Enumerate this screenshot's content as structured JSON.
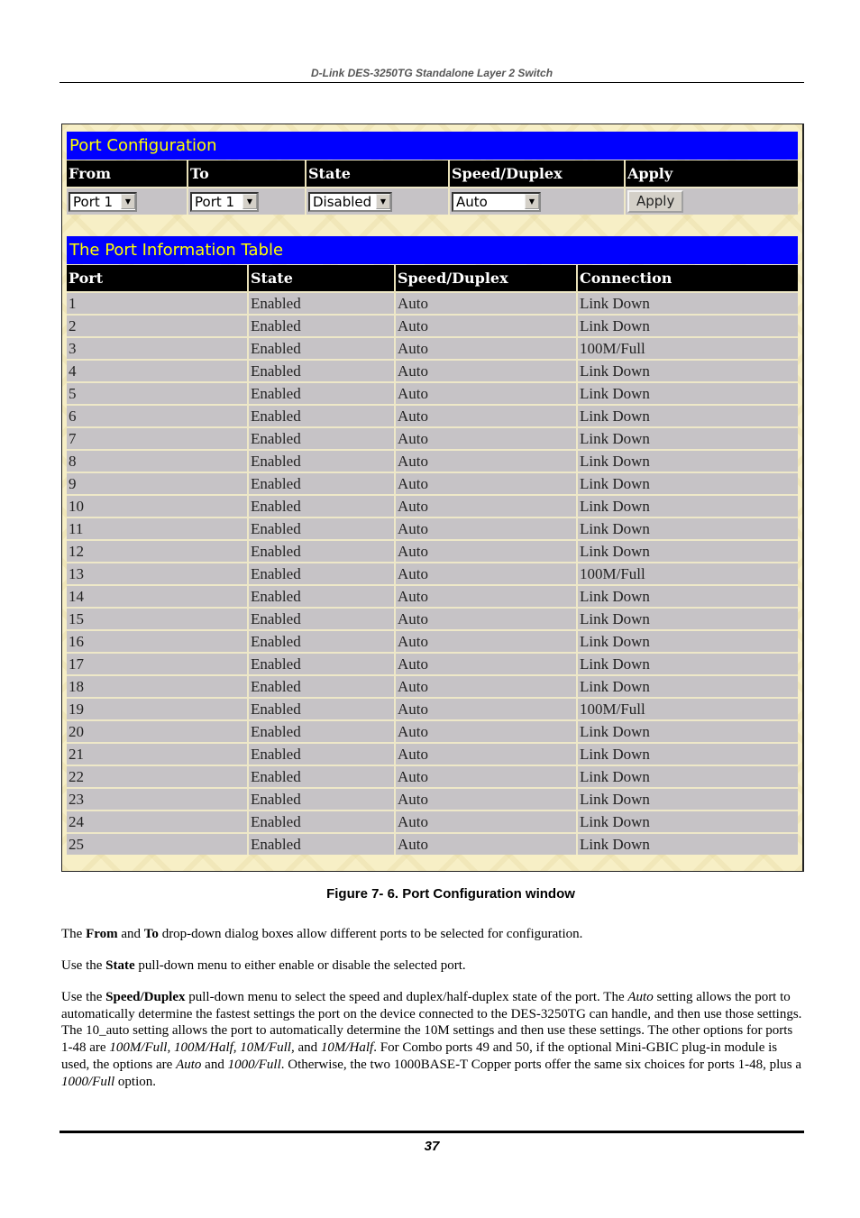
{
  "document": {
    "header_title": "D-Link DES-3250TG Standalone Layer 2 Switch",
    "caption": "Figure 7- 6.  Port Configuration window",
    "page_number": "37",
    "paragraphs": [
      [
        {
          "t": "The ",
          "s": "n"
        },
        {
          "t": "From",
          "s": "b"
        },
        {
          "t": " and ",
          "s": "n"
        },
        {
          "t": "To",
          "s": "b"
        },
        {
          "t": " drop-down dialog boxes allow different ports to be selected for configuration.",
          "s": "n"
        }
      ],
      [
        {
          "t": "Use the ",
          "s": "n"
        },
        {
          "t": "State",
          "s": "b"
        },
        {
          "t": " pull-down menu to either enable or disable the selected port.",
          "s": "n"
        }
      ],
      [
        {
          "t": "Use the ",
          "s": "n"
        },
        {
          "t": "Speed/Duplex",
          "s": "b"
        },
        {
          "t": " pull-down menu to select the speed and duplex/half-duplex state of the port. The ",
          "s": "n"
        },
        {
          "t": "Auto",
          "s": "i"
        },
        {
          "t": " setting allows the port to automatically determine the fastest settings the port on the device connected to the DES-3250TG can handle, and then use those settings.  The 10_auto setting allows the port to automatically determine the 10M settings and then use these settings. The other options for ports 1-48 are ",
          "s": "n"
        },
        {
          "t": "100M/Full, 100M/Half, 10M/Full,",
          "s": "i"
        },
        {
          "t": " and ",
          "s": "n"
        },
        {
          "t": "10M/Half",
          "s": "i"
        },
        {
          "t": ". For Combo ports 49 and 50, if the optional Mini-GBIC plug-in module is used, the options are ",
          "s": "n"
        },
        {
          "t": "Auto",
          "s": "i"
        },
        {
          "t": " and ",
          "s": "n"
        },
        {
          "t": "1000/Full",
          "s": "i"
        },
        {
          "t": ". Otherwise, the two 1000BASE-T Copper ports offer the same six choices for ports 1-48, plus a ",
          "s": "n"
        },
        {
          "t": "1000/Full",
          "s": "i"
        },
        {
          "t": " option.",
          "s": "n"
        }
      ]
    ]
  },
  "port_config": {
    "title": "Port Configuration",
    "columns": [
      "From",
      "To",
      "State",
      "Speed/Duplex",
      "Apply"
    ],
    "from_value": "Port 1",
    "to_value": "Port 1",
    "state_value": "Disabled",
    "speed_duplex_value": "Auto",
    "apply_label": "Apply",
    "dropdown_icon": "chevron-down-icon",
    "colors": {
      "title_bar": "#0000ff",
      "title_text": "#ffff00",
      "header_bg": "#000000",
      "row_bg": "#c6c3c6"
    }
  },
  "port_info": {
    "title": "The Port Information Table",
    "columns": [
      "Port",
      "State",
      "Speed/Duplex",
      "Connection"
    ],
    "rows": [
      [
        "1",
        "Enabled",
        "Auto",
        "Link Down"
      ],
      [
        "2",
        "Enabled",
        "Auto",
        "Link Down"
      ],
      [
        "3",
        "Enabled",
        "Auto",
        "100M/Full"
      ],
      [
        "4",
        "Enabled",
        "Auto",
        "Link Down"
      ],
      [
        "5",
        "Enabled",
        "Auto",
        "Link Down"
      ],
      [
        "6",
        "Enabled",
        "Auto",
        "Link Down"
      ],
      [
        "7",
        "Enabled",
        "Auto",
        "Link Down"
      ],
      [
        "8",
        "Enabled",
        "Auto",
        "Link Down"
      ],
      [
        "9",
        "Enabled",
        "Auto",
        "Link Down"
      ],
      [
        "10",
        "Enabled",
        "Auto",
        "Link Down"
      ],
      [
        "11",
        "Enabled",
        "Auto",
        "Link Down"
      ],
      [
        "12",
        "Enabled",
        "Auto",
        "Link Down"
      ],
      [
        "13",
        "Enabled",
        "Auto",
        "100M/Full"
      ],
      [
        "14",
        "Enabled",
        "Auto",
        "Link Down"
      ],
      [
        "15",
        "Enabled",
        "Auto",
        "Link Down"
      ],
      [
        "16",
        "Enabled",
        "Auto",
        "Link Down"
      ],
      [
        "17",
        "Enabled",
        "Auto",
        "Link Down"
      ],
      [
        "18",
        "Enabled",
        "Auto",
        "Link Down"
      ],
      [
        "19",
        "Enabled",
        "Auto",
        "100M/Full"
      ],
      [
        "20",
        "Enabled",
        "Auto",
        "Link Down"
      ],
      [
        "21",
        "Enabled",
        "Auto",
        "Link Down"
      ],
      [
        "22",
        "Enabled",
        "Auto",
        "Link Down"
      ],
      [
        "23",
        "Enabled",
        "Auto",
        "Link Down"
      ],
      [
        "24",
        "Enabled",
        "Auto",
        "Link Down"
      ],
      [
        "25",
        "Enabled",
        "Auto",
        "Link Down"
      ]
    ]
  }
}
